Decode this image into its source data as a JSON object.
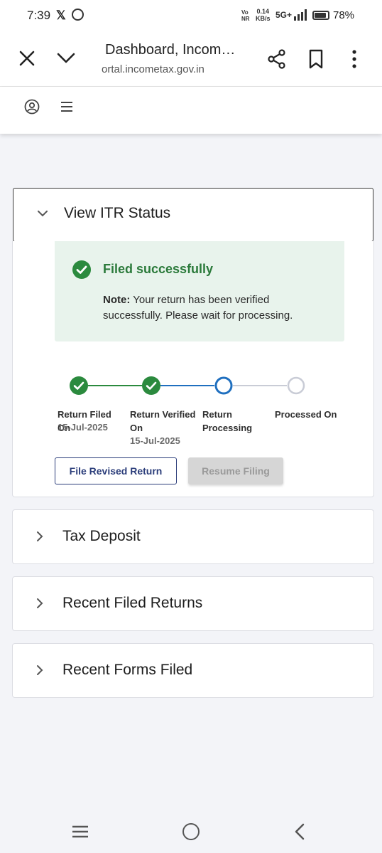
{
  "status_bar": {
    "time": "7:39",
    "volte": [
      "Vo",
      "NR"
    ],
    "speed": [
      "0.14",
      "KB/s"
    ],
    "network": "5G+",
    "battery_percent": "78%",
    "battery_level": 0.78,
    "icons": [
      "x-icon",
      "whatsapp-icon",
      "signal-icon",
      "battery-icon"
    ]
  },
  "browser": {
    "title": "Dashboard, Income Tax Portal",
    "url": "ortal.incometax.gov.in",
    "icons": [
      "close-icon",
      "chevron-down-icon",
      "share-icon",
      "bookmark-icon",
      "more-vert-icon"
    ]
  },
  "site_header": {
    "icons": [
      "profile-icon",
      "hamburger-icon"
    ]
  },
  "itr_status": {
    "title": "View ITR Status",
    "success_title": "Filed successfully",
    "note_label": "Note:",
    "note_text": " Your return has been verified successfully. Please wait for processing.",
    "steps": [
      {
        "label": "Return Filed On",
        "date": "15-Jul-2025",
        "state": "done"
      },
      {
        "label": "Return Verified On",
        "date": "15-Jul-2025",
        "state": "done"
      },
      {
        "label": "Return Processing",
        "date": "",
        "state": "current"
      },
      {
        "label": "Processed On",
        "date": "",
        "state": "pending"
      }
    ],
    "buttons": {
      "file_revised": "File Revised Return",
      "resume_filing": "Resume Filing"
    }
  },
  "sections": [
    {
      "title": "Tax Deposit"
    },
    {
      "title": "Recent Filed Returns"
    },
    {
      "title": "Recent Forms Filed"
    }
  ],
  "colors": {
    "success_green": "#2b8a3e",
    "progress_blue": "#1f6fbf",
    "pending_grey": "#c9ccd6",
    "primary_navy": "#2b3d7a",
    "success_bg": "#e8f3ec"
  },
  "nav_bar": {
    "icons": [
      "recents-icon",
      "home-icon",
      "back-icon"
    ]
  }
}
